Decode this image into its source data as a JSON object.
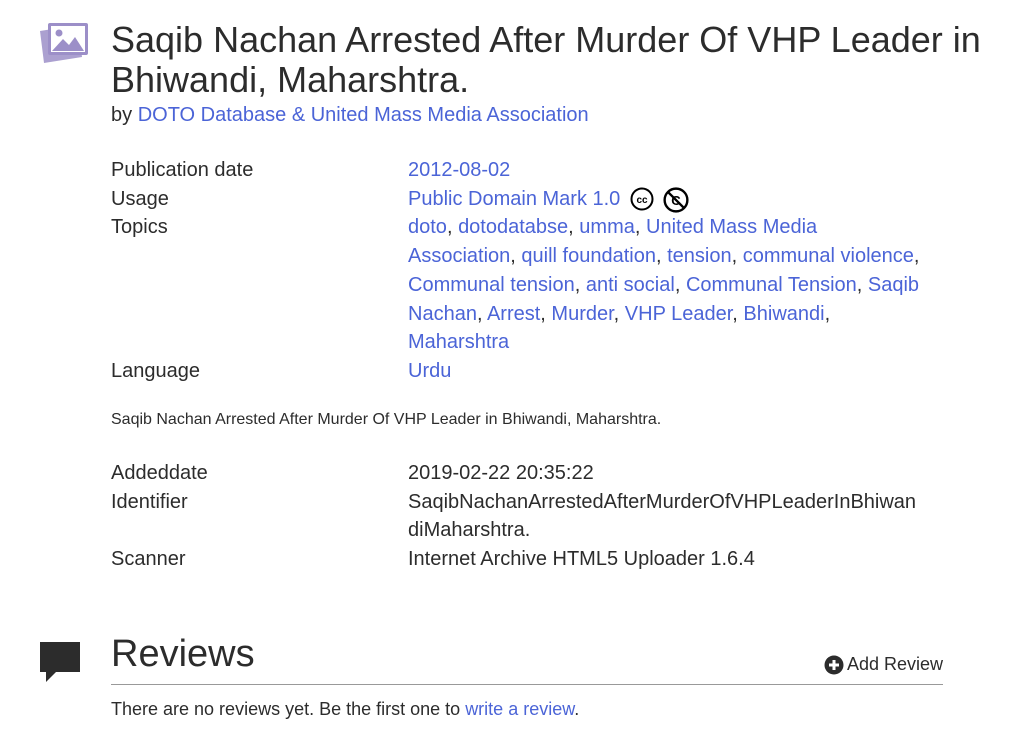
{
  "item": {
    "icon": "image-gallery-icon",
    "title": "Saqib Nachan Arrested After Murder Of VHP Leader in Bhiwandi, Maharshtra.",
    "by_label": "by",
    "creator": "DOTO Database & United Mass Media Association"
  },
  "metadata": {
    "publication_date_label": "Publication date",
    "publication_date": "2012-08-02",
    "usage_label": "Usage",
    "usage_value": "Public Domain Mark 1.0",
    "usage_icons": [
      "cc-icon",
      "public-domain-icon"
    ],
    "topics_label": "Topics",
    "topics": [
      "doto",
      "dotodatabse",
      "umma",
      "United Mass Media Association",
      "quill foundation",
      "tension",
      "communal violence",
      "Communal tension",
      "anti social",
      "Communal Tension",
      "Saqib Nachan",
      "Arrest",
      "Murder",
      "VHP Leader",
      "Bhiwandi",
      "Maharshtra"
    ],
    "topics_separator": ", ",
    "language_label": "Language",
    "language": "Urdu"
  },
  "description": "Saqib Nachan Arrested After Murder Of VHP Leader in Bhiwandi, Maharshtra.",
  "metadata2": {
    "addeddate_label": "Addeddate",
    "addeddate": "2019-02-22 20:35:22",
    "identifier_label": "Identifier",
    "identifier": "SaqibNachanArrestedAfterMurderOfVHPLeaderInBhiwandiMaharshtra.",
    "scanner_label": "Scanner",
    "scanner": "Internet Archive HTML5 Uploader 1.6.4"
  },
  "reviews": {
    "icon": "speech-bubble-icon",
    "title": "Reviews",
    "add_icon": "plus-circle-icon",
    "add_label": "Add Review",
    "empty_text": "There are no reviews yet. Be the first one to ",
    "empty_link": "write a review",
    "empty_end": "."
  }
}
